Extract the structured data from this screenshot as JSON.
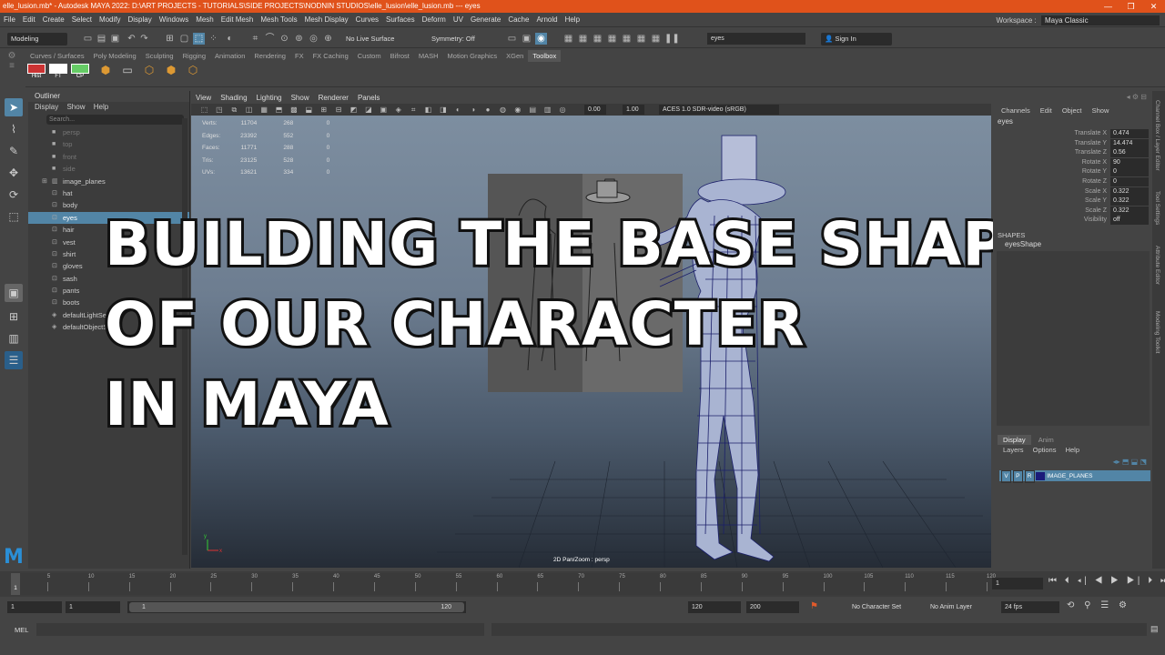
{
  "window": {
    "title": "elle_lusion.mb* - Autodesk MAYA 2022: D:\\ART PROJECTS - TUTORIALS\\SIDE PROJECTS\\NODNIN STUDIOS\\elle_lusion\\elle_lusion.mb  ---  eyes",
    "minimize": "—",
    "maximize": "❐",
    "close": "✕"
  },
  "menubar": [
    "File",
    "Edit",
    "Create",
    "Select",
    "Modify",
    "Display",
    "Windows",
    "Mesh",
    "Edit Mesh",
    "Mesh Tools",
    "Mesh Display",
    "Curves",
    "Surfaces",
    "Deform",
    "UV",
    "Generate",
    "Cache",
    "Arnold",
    "Help"
  ],
  "workspace": {
    "label": "Workspace :",
    "value": "Maya Classic"
  },
  "statusline": {
    "mode": "Modeling",
    "live_surface": "No Live Surface",
    "symmetry": "Symmetry: Off",
    "search_value": "eyes",
    "sign_in": "Sign In"
  },
  "shelf": {
    "tabs": [
      "Curves / Surfaces",
      "Poly Modeling",
      "Sculpting",
      "Rigging",
      "Animation",
      "Rendering",
      "FX",
      "FX Caching",
      "Custom",
      "Bifrost",
      "MASH",
      "Motion Graphics",
      "XGen",
      "Toolbox"
    ],
    "active_tab": "Toolbox",
    "buttons": [
      "Hist",
      "FT",
      "CP"
    ]
  },
  "outliner": {
    "title": "Outliner",
    "menu": [
      "Display",
      "Show",
      "Help"
    ],
    "search_placeholder": "Search...",
    "items": [
      {
        "label": "persp",
        "state": "dim"
      },
      {
        "label": "top",
        "state": "dim"
      },
      {
        "label": "front",
        "state": "dim"
      },
      {
        "label": "side",
        "state": "dim"
      },
      {
        "label": "image_planes",
        "state": "group"
      },
      {
        "label": "hat",
        "state": ""
      },
      {
        "label": "body",
        "state": ""
      },
      {
        "label": "eyes",
        "state": "selected"
      },
      {
        "label": "hair",
        "state": ""
      },
      {
        "label": "vest",
        "state": ""
      },
      {
        "label": "shirt",
        "state": ""
      },
      {
        "label": "gloves",
        "state": ""
      },
      {
        "label": "sash",
        "state": ""
      },
      {
        "label": "pants",
        "state": ""
      },
      {
        "label": "boots",
        "state": ""
      },
      {
        "label": "defaultLightSet",
        "state": "set"
      },
      {
        "label": "defaultObjectSet",
        "state": "set"
      }
    ]
  },
  "viewport": {
    "menu": [
      "View",
      "Shading",
      "Lighting",
      "Show",
      "Renderer",
      "Panels"
    ],
    "exposure": "0.00",
    "gamma": "1.00",
    "color_space": "ACES 1.0 SDR-video (sRGB)",
    "camera_label": "2D Pan/Zoom : persp",
    "hud": [
      [
        "Verts:",
        "11704",
        "268",
        "0"
      ],
      [
        "Edges:",
        "23392",
        "552",
        "0"
      ],
      [
        "Faces:",
        "11771",
        "288",
        "0"
      ],
      [
        "Tris:",
        "23125",
        "528",
        "0"
      ],
      [
        "UVs:",
        "13621",
        "334",
        "0"
      ]
    ]
  },
  "overlay": {
    "line1": "BUILDING THE BASE SHAPE",
    "line2": "OF OUR CHARACTER",
    "line3": "IN MAYA"
  },
  "channelbox": {
    "menu": [
      "Channels",
      "Edit",
      "Object",
      "Show"
    ],
    "object": "eyes",
    "attrs": [
      {
        "k": "Translate X",
        "v": "0.474"
      },
      {
        "k": "Translate Y",
        "v": "14.474"
      },
      {
        "k": "Translate Z",
        "v": "0.56"
      },
      {
        "k": "Rotate X",
        "v": "90"
      },
      {
        "k": "Rotate Y",
        "v": "0"
      },
      {
        "k": "Rotate Z",
        "v": "0"
      },
      {
        "k": "Scale X",
        "v": "0.322"
      },
      {
        "k": "Scale Y",
        "v": "0.322"
      },
      {
        "k": "Scale Z",
        "v": "0.322"
      },
      {
        "k": "Visibility",
        "v": "off"
      }
    ],
    "shapes_header": "SHAPES",
    "shape": "eyesShape"
  },
  "layers": {
    "tabs": [
      "Display",
      "Anim"
    ],
    "menu": [
      "Layers",
      "Options",
      "Help"
    ],
    "layer": {
      "v": "V",
      "p": "P",
      "r": "R",
      "name": "IMAGE_PLANES"
    }
  },
  "side_tabs": [
    "Channel Box / Layer Editor",
    "Tool Settings",
    "Attribute Editor",
    "Modeling Toolkit"
  ],
  "timeline": {
    "ticks": [
      "1",
      "5",
      "10",
      "15",
      "20",
      "25",
      "30",
      "35",
      "40",
      "45",
      "50",
      "55",
      "60",
      "65",
      "70",
      "75",
      "80",
      "85",
      "90",
      "95",
      "100",
      "105",
      "110",
      "115",
      "120"
    ],
    "current_frame": "1"
  },
  "range": {
    "start": "1",
    "inner_start": "1",
    "slider_start": "1",
    "slider_end": "120",
    "end": "120",
    "anim_end": "200",
    "char_set": "No Character Set",
    "anim_layer": "No Anim Layer",
    "fps": "24 fps"
  },
  "cmdline": {
    "label": "MEL"
  },
  "colors": {
    "titlebar": "#e0521b",
    "selection": "#5285a6",
    "layer_color": "#1b1b7a",
    "accent_blue": "#2a8fd6"
  }
}
